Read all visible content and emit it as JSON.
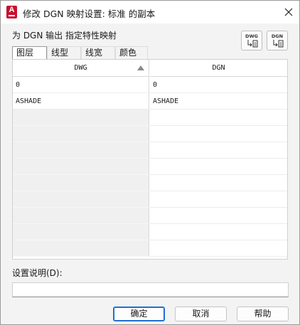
{
  "window": {
    "title": "修改 DGN 映射设置: 标准 的副本",
    "app_icon_letter": "A",
    "close_icon": "close-icon"
  },
  "mapping": {
    "label": "为 DGN 输出 指定特性映射",
    "dwg_to_dgn_button_label": "DWG",
    "dgn_to_dwg_button_label": "DGN"
  },
  "tabs": [
    {
      "label": "图层",
      "active": true
    },
    {
      "label": "线型",
      "active": false
    },
    {
      "label": "线宽",
      "active": false
    },
    {
      "label": "颜色",
      "active": false
    }
  ],
  "grid": {
    "headers": {
      "left": "DWG",
      "right": "DGN"
    },
    "sort_icon": "sort-ascending-icon",
    "rows": [
      {
        "dwg": "0",
        "dgn": "0"
      },
      {
        "dwg": "ASHADE",
        "dgn": "ASHADE"
      }
    ],
    "empty_row_count": 9
  },
  "description": {
    "label": "设置说明(D):",
    "value": ""
  },
  "buttons": {
    "ok": "确定",
    "cancel": "取消",
    "help": "帮助"
  }
}
